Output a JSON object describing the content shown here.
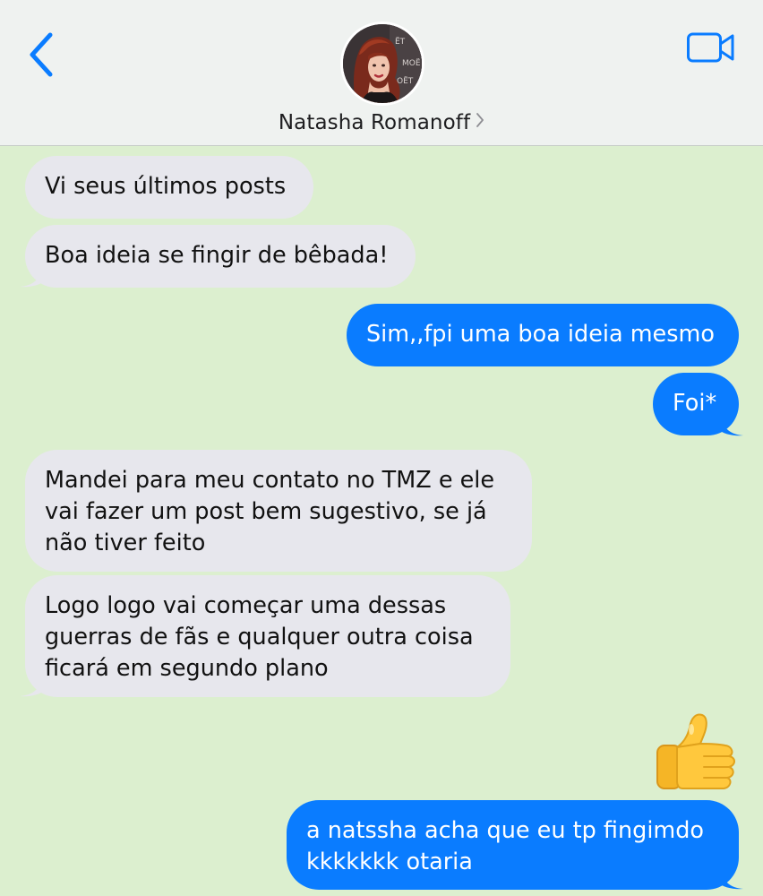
{
  "header": {
    "contact_name": "Natasha Romanoff",
    "back_icon": "chevron-left-icon",
    "video_icon": "video-camera-icon",
    "accent_color": "#0a7cff"
  },
  "messages": [
    {
      "direction": "incoming",
      "text": "Vi seus últimos posts"
    },
    {
      "direction": "incoming",
      "text": "Boa ideia se fingir de bêbada!"
    },
    {
      "direction": "outgoing",
      "text": "Sim,,fpi uma boa ideia mesmo"
    },
    {
      "direction": "outgoing",
      "text": "Foi*"
    },
    {
      "direction": "incoming",
      "lines": [
        "Mandei para meu contato no TMZ e ele",
        "vai fazer um post bem sugestivo, se já",
        "não tiver feito"
      ]
    },
    {
      "direction": "incoming",
      "lines": [
        "Logo logo vai começar uma dessas",
        "guerras de fãs e qualquer outra coisa",
        "ficará em segundo plano"
      ]
    },
    {
      "direction": "outgoing",
      "emoji": "thumbs-up"
    },
    {
      "direction": "outgoing",
      "lines": [
        "a natssha acha que eu tp fingimdo",
        "kkkkkkk otaria"
      ]
    }
  ],
  "colors": {
    "background": "#dcefcf",
    "incoming_bubble": "#e7e7ed",
    "outgoing_bubble": "#0a7cff"
  }
}
